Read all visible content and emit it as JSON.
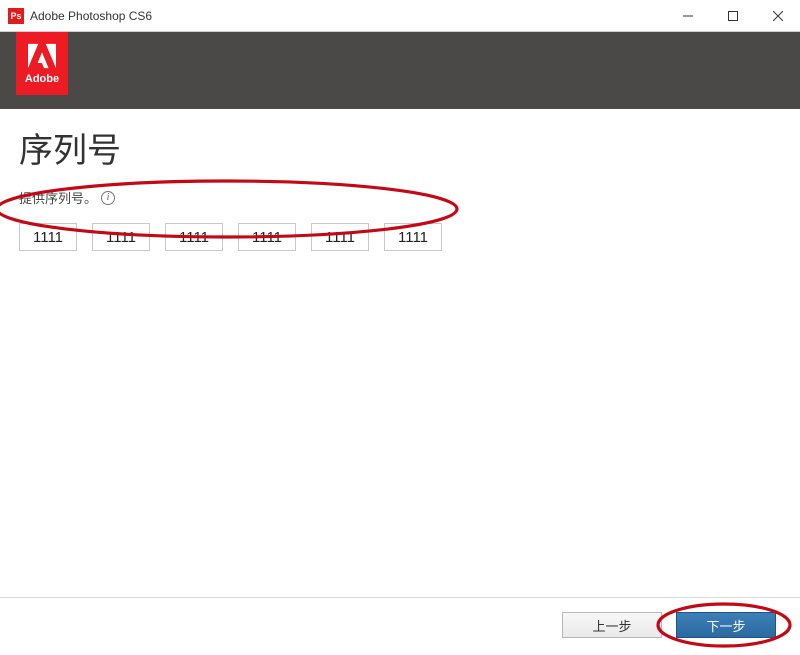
{
  "window": {
    "title": "Adobe Photoshop CS6"
  },
  "logo": {
    "brand": "Adobe"
  },
  "page": {
    "title": "序列号",
    "subtitle": "提供序列号。"
  },
  "serial": {
    "fields": [
      "1111",
      "1111",
      "1111",
      "1111",
      "1111",
      "1111"
    ]
  },
  "footer": {
    "back": "上一步",
    "next": "下一步"
  },
  "annotation": {
    "color": "#c20915"
  }
}
